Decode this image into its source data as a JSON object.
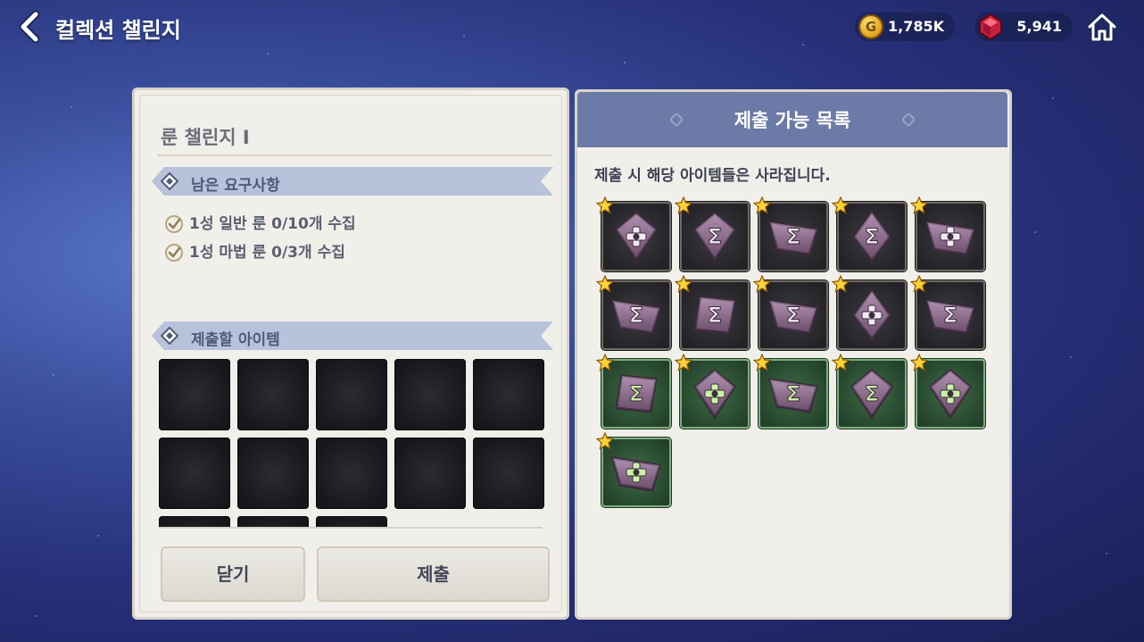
{
  "header": {
    "title": "컬렉션 챌린지",
    "gold": "1,785K",
    "gems": "5,941"
  },
  "challenge": {
    "name": "룬 챌린지 I",
    "requirements_label": "남은 요구사항",
    "requirements": [
      "1성 일반 룬 0/10개 수집",
      "1성 마법 룬 0/3개 수집"
    ],
    "submit_items_label": "제출할 아이템",
    "close_button": "닫기",
    "submit_button": "제출"
  },
  "submittable": {
    "title": "제출 가능 목록",
    "hint": "제출 시 해당 아이템들은 사라집니다.",
    "items": [
      {
        "grade": "normal",
        "shape": "diamond",
        "glyph": "cross"
      },
      {
        "grade": "normal",
        "shape": "diamond",
        "glyph": "sigma"
      },
      {
        "grade": "normal",
        "shape": "trapezoid",
        "glyph": "sigma"
      },
      {
        "grade": "normal",
        "shape": "rhombus",
        "glyph": "sigma"
      },
      {
        "grade": "normal",
        "shape": "trapezoid",
        "glyph": "cross"
      },
      {
        "grade": "normal",
        "shape": "trapezoid",
        "glyph": "sigma"
      },
      {
        "grade": "normal",
        "shape": "parallelogram",
        "glyph": "sigma"
      },
      {
        "grade": "normal",
        "shape": "trapezoid",
        "glyph": "sigma"
      },
      {
        "grade": "normal",
        "shape": "rhombus",
        "glyph": "cross"
      },
      {
        "grade": "normal",
        "shape": "trapezoid",
        "glyph": "sigma"
      },
      {
        "grade": "magic",
        "shape": "parallelogram",
        "glyph": "sigma"
      },
      {
        "grade": "magic",
        "shape": "diamond",
        "glyph": "cross"
      },
      {
        "grade": "magic",
        "shape": "trapezoid",
        "glyph": "sigma"
      },
      {
        "grade": "magic",
        "shape": "diamond",
        "glyph": "sigma"
      },
      {
        "grade": "magic",
        "shape": "diamond",
        "glyph": "cross"
      },
      {
        "grade": "magic",
        "shape": "trapezoid",
        "glyph": "cross"
      }
    ]
  }
}
